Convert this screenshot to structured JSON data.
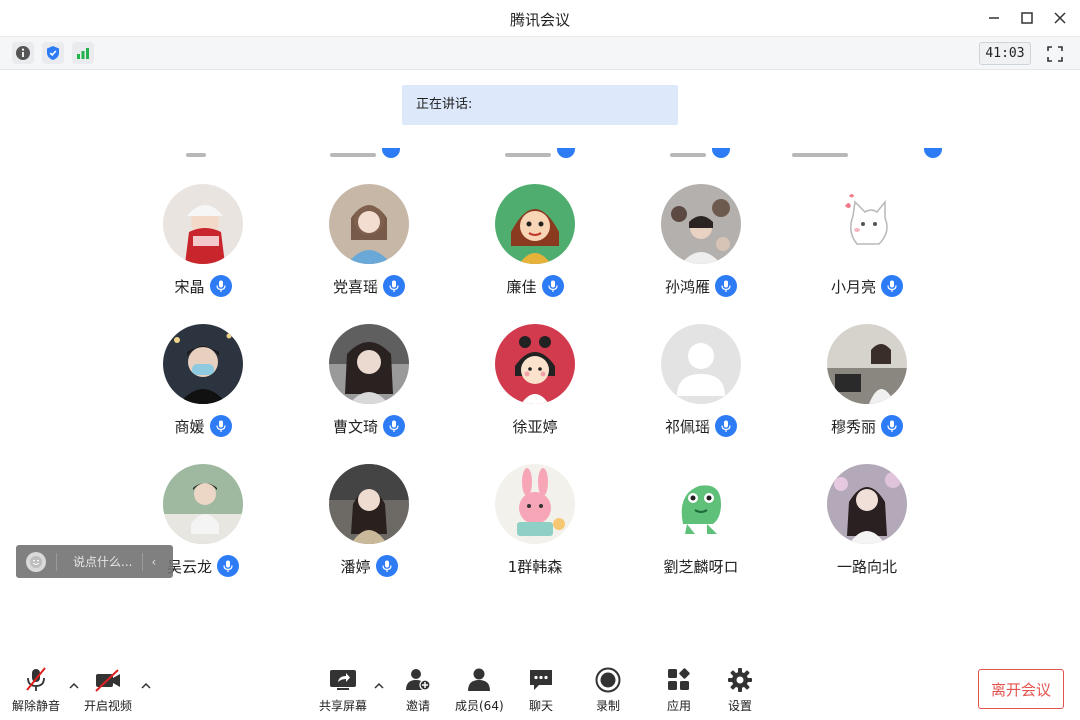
{
  "window": {
    "title": "腾讯会议"
  },
  "statusbar": {
    "icons": [
      "info-icon",
      "shield-icon",
      "signal-icon"
    ],
    "timer": "41:03"
  },
  "speaking": {
    "label": "正在讲话:"
  },
  "participants": [
    {
      "name": "宋晶",
      "avatar": "girl-hat",
      "mic": true
    },
    {
      "name": "党喜瑶",
      "avatar": "girl-selfie",
      "mic": true
    },
    {
      "name": "廉佳",
      "avatar": "cartoon-girl",
      "mic": true
    },
    {
      "name": "孙鸿雁",
      "avatar": "crowd-photo",
      "mic": true
    },
    {
      "name": "小月亮",
      "avatar": "cartoon-cat",
      "mic": true
    },
    {
      "name": "商媛",
      "avatar": "man-mask",
      "mic": true
    },
    {
      "name": "曹文琦",
      "avatar": "girl-car",
      "mic": true
    },
    {
      "name": "徐亚婷",
      "avatar": "maruko",
      "mic": false
    },
    {
      "name": "祁佩瑶",
      "avatar": "default-person",
      "mic": true
    },
    {
      "name": "穆秀丽",
      "avatar": "room-photo",
      "mic": true
    },
    {
      "name": "吴云龙",
      "avatar": "boy-desk",
      "mic": true
    },
    {
      "name": "潘婷",
      "avatar": "girl-sitting",
      "mic": true
    },
    {
      "name": "1群韩森",
      "avatar": "cartoon-rabbit",
      "mic": false
    },
    {
      "name": "劉芝麟呀ロ",
      "avatar": "green-dino",
      "mic": false
    },
    {
      "name": "一路向北",
      "avatar": "girl-flowers",
      "mic": false
    }
  ],
  "chat": {
    "placeholder": "说点什么..."
  },
  "toolbar": {
    "unmute": "解除静音",
    "start_video": "开启视频",
    "share_screen": "共享屏幕",
    "invite": "邀请",
    "members": "成员(64)",
    "chat": "聊天",
    "record": "录制",
    "apps": "应用",
    "settings": "设置",
    "leave": "离开会议"
  },
  "colors": {
    "accent": "#2d7cf6",
    "leave": "#e3534e",
    "speaking_bg": "#dde9fb",
    "mute_red": "#e02020"
  }
}
